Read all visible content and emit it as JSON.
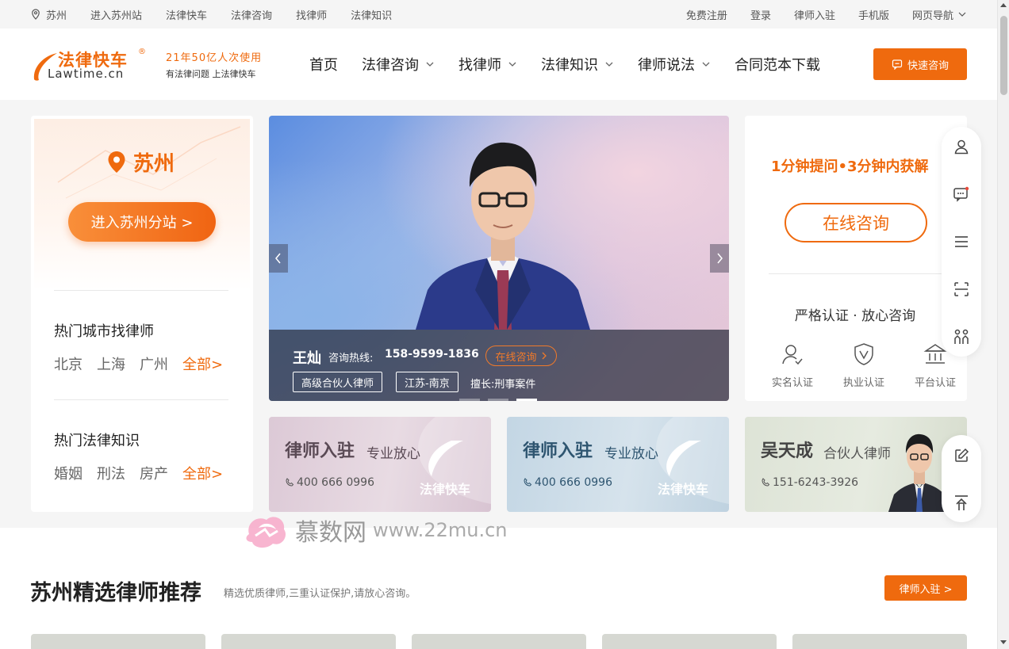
{
  "topbar": {
    "location": "苏州",
    "links": [
      "进入苏州站",
      "法律快车",
      "法律咨询",
      "找律师",
      "法律知识"
    ],
    "right_links": [
      "免费注册",
      "登录",
      "律师入驻",
      "手机版",
      "网页导航"
    ]
  },
  "logo": {
    "cn": "法律快车",
    "reg": "®",
    "en": "Lawtime.cn"
  },
  "slogan": {
    "line1": "21年50亿人次使用",
    "line2": "有法律问题 上法律快车"
  },
  "nav": {
    "items": [
      {
        "label": "首页",
        "has_dropdown": false
      },
      {
        "label": "法律咨询",
        "has_dropdown": true
      },
      {
        "label": "找律师",
        "has_dropdown": true
      },
      {
        "label": "法律知识",
        "has_dropdown": true
      },
      {
        "label": "律师说法",
        "has_dropdown": true
      },
      {
        "label": "合同范本下载",
        "has_dropdown": false
      }
    ],
    "quick_consult": "快速咨询"
  },
  "city_card": {
    "city": "苏州",
    "enter_button": "进入苏州分站 >",
    "hot_city_title": "热门城市找律师",
    "hot_cities": [
      "北京",
      "上海",
      "广州"
    ],
    "hot_cities_all": "全部>",
    "hot_knowledge_title": "热门法律知识",
    "hot_knowledge": [
      "婚姻",
      "刑法",
      "房产"
    ],
    "hot_knowledge_all": "全部>"
  },
  "carousel": {
    "name": "王灿",
    "hotline_label": "咨询热线:",
    "hotline": "158-9599-1836",
    "online_button": "在线咨询",
    "tags": [
      "高级合伙人律师",
      "江苏-南京"
    ],
    "specialty": "擅长:刑事案件",
    "slide_count": 3,
    "active_slide": 3
  },
  "consult_card": {
    "headline": "1分钟提问•3分钟内获解",
    "online_button": "在线咨询",
    "strict": "严格认证 · 放心咨询",
    "certs": [
      "实名认证",
      "执业认证",
      "平台认证"
    ]
  },
  "banners": [
    {
      "title": "律师入驻",
      "sub": "专业放心",
      "phone": "400 666 0996",
      "logo": "法律快车"
    },
    {
      "title": "律师入驻",
      "sub": "专业放心",
      "phone": "400 666 0996",
      "logo": "法律快车"
    },
    {
      "title": "吴天成",
      "sub": "合伙人律师",
      "phone": "151-6243-3926"
    }
  ],
  "recommend": {
    "title": "苏州精选律师推荐",
    "desc": "精选优质律师,三重认证保护,请放心咨询。",
    "join_button": "律师入驻 >"
  },
  "watermark": {
    "cn": "慕数网",
    "en": "www.22mu.cn"
  },
  "colors": {
    "accent": "#ef6a0e",
    "text": "#333333",
    "bg": "#f5f5f5"
  }
}
